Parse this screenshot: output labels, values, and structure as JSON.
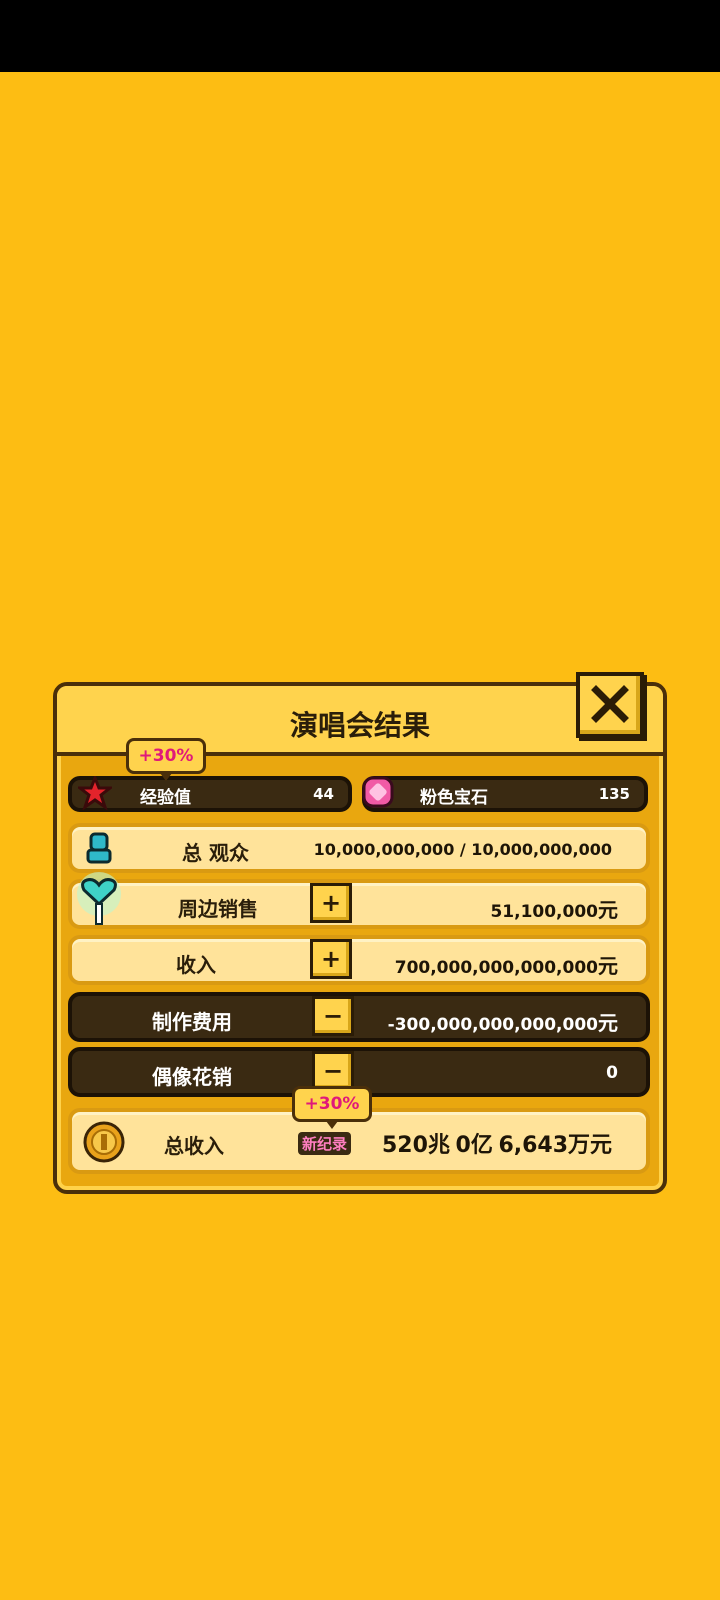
{
  "dialog": {
    "title": "演唱会结果",
    "close_icon": "close-x-icon",
    "exp": {
      "bonus": "+30%",
      "label": "经验值",
      "value": "44",
      "icon": "red-star-icon"
    },
    "gems": {
      "label": "粉色宝石",
      "value": "135",
      "icon": "pink-gem-icon"
    },
    "audience": {
      "label": "总 观众",
      "value": "10,000,000,000 / 10,000,000,000",
      "icon": "person-icon"
    },
    "merch": {
      "label": "周边销售",
      "sign": "+",
      "value": "51,100,000",
      "unit": "元",
      "icon": "heart-lollipop-icon"
    },
    "income": {
      "label": "收入",
      "sign": "+",
      "value": "700,000,000,000,000",
      "unit": "元"
    },
    "production": {
      "label": "制作费用",
      "sign": "−",
      "value": "-300,000,000,000,000",
      "unit": "元"
    },
    "idol_cost": {
      "label": "偶像花销",
      "sign": "−",
      "value": "0"
    },
    "total": {
      "bonus": "+30%",
      "record": "新纪录",
      "label": "总收入",
      "icon": "coin-icon",
      "n1": "520",
      "u1": "兆",
      "n2": "0",
      "u2": "亿",
      "n3": "6,643",
      "u3": "万元"
    }
  },
  "colors": {
    "background": "#FDBD13",
    "accent_pink": "#E0197A",
    "dark_row": "#3A2A12"
  }
}
